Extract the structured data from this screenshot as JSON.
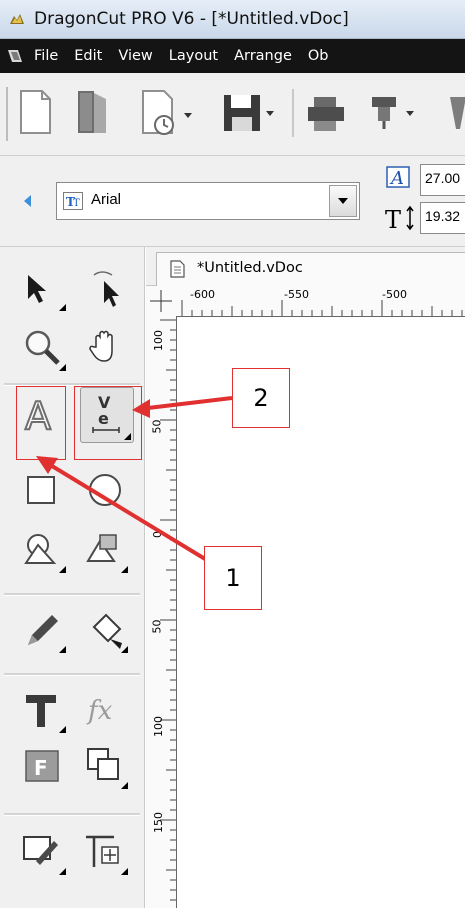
{
  "window": {
    "title": "DragonCut PRO V6 - [*Untitled.vDoc]"
  },
  "menu": [
    "File",
    "Edit",
    "View",
    "Layout",
    "Arrange",
    "Ob"
  ],
  "toolbar": {
    "icons": [
      "new-doc-icon",
      "open-doc-icon",
      "recent-doc-icon",
      "save-icon",
      "print-icon",
      "cut-plotter-icon",
      "laser-icon"
    ]
  },
  "font_bar": {
    "font_name": "Arial",
    "width_value": "27.00",
    "height_value": "19.32"
  },
  "document": {
    "tab_label": "*Untitled.vDoc"
  },
  "rulers": {
    "horizontal": [
      "-600",
      "-550",
      "-500"
    ],
    "vertical": [
      "100",
      "50",
      "0",
      "50",
      "100",
      "150"
    ]
  },
  "annotations": {
    "callout_1": "1",
    "callout_2": "2"
  },
  "colors": {
    "annotation_red": "#e03030",
    "menubar_bg": "#141414",
    "panel_bg": "#f0f0f0"
  }
}
